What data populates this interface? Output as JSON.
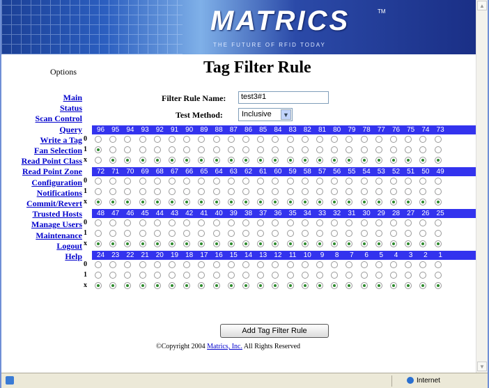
{
  "banner": {
    "logo_text": "MATRICS",
    "tm": "TM",
    "tagline": "THE FUTURE OF RFID TODAY"
  },
  "page": {
    "title": "Tag Filter Rule",
    "options_label": "Options"
  },
  "sidebar": {
    "items": [
      {
        "label": "Main"
      },
      {
        "label": "Status"
      },
      {
        "label": "Scan Control"
      },
      {
        "label": "Query"
      },
      {
        "label": "Write a Tag"
      },
      {
        "label": "Fan Selection"
      },
      {
        "label": "Read Point Class"
      },
      {
        "label": "Read Point Zone"
      },
      {
        "label": "Configuration"
      },
      {
        "label": "Notifications"
      },
      {
        "label": "Commit/Revert"
      },
      {
        "label": "Trusted Hosts"
      },
      {
        "label": "Manage Users"
      },
      {
        "label": "Maintenance"
      },
      {
        "label": "Logout"
      },
      {
        "label": "Help"
      }
    ]
  },
  "form": {
    "name_label": "Filter Rule Name:",
    "name_value": "test3#1",
    "method_label": "Test Method:",
    "method_value": "Inclusive",
    "add_button": "Add Tag Filter Rule"
  },
  "bit_grid": {
    "row_labels": [
      "0",
      "1",
      "x"
    ],
    "groups": [
      {
        "bits": [
          "96",
          "95",
          "94",
          "93",
          "92",
          "91",
          "90",
          "89",
          "88",
          "87",
          "86",
          "85",
          "84",
          "83",
          "82",
          "81",
          "80",
          "79",
          "78",
          "77",
          "76",
          "75",
          "74",
          "73"
        ],
        "selected": [
          "1",
          "x",
          "x",
          "x",
          "x",
          "x",
          "x",
          "x",
          "x",
          "x",
          "x",
          "x",
          "x",
          "x",
          "x",
          "x",
          "x",
          "x",
          "x",
          "x",
          "x",
          "x",
          "x",
          "x"
        ]
      },
      {
        "bits": [
          "72",
          "71",
          "70",
          "69",
          "68",
          "67",
          "66",
          "65",
          "64",
          "63",
          "62",
          "61",
          "60",
          "59",
          "58",
          "57",
          "56",
          "55",
          "54",
          "53",
          "52",
          "51",
          "50",
          "49"
        ],
        "selected": [
          "x",
          "x",
          "x",
          "x",
          "x",
          "x",
          "x",
          "x",
          "x",
          "x",
          "x",
          "x",
          "x",
          "x",
          "x",
          "x",
          "x",
          "x",
          "x",
          "x",
          "x",
          "x",
          "x",
          "x"
        ]
      },
      {
        "bits": [
          "48",
          "47",
          "46",
          "45",
          "44",
          "43",
          "42",
          "41",
          "40",
          "39",
          "38",
          "37",
          "36",
          "35",
          "34",
          "33",
          "32",
          "31",
          "30",
          "29",
          "28",
          "27",
          "26",
          "25"
        ],
        "selected": [
          "x",
          "x",
          "x",
          "x",
          "x",
          "x",
          "x",
          "x",
          "x",
          "x",
          "x",
          "x",
          "x",
          "x",
          "x",
          "x",
          "x",
          "x",
          "x",
          "x",
          "x",
          "x",
          "x",
          "x"
        ]
      },
      {
        "bits": [
          "24",
          "23",
          "22",
          "21",
          "20",
          "19",
          "18",
          "17",
          "16",
          "15",
          "14",
          "13",
          "12",
          "11",
          "10",
          "9",
          "8",
          "7",
          "6",
          "5",
          "4",
          "3",
          "2",
          "1"
        ],
        "selected": [
          "x",
          "x",
          "x",
          "x",
          "x",
          "x",
          "x",
          "x",
          "x",
          "x",
          "x",
          "x",
          "x",
          "x",
          "x",
          "x",
          "x",
          "x",
          "x",
          "x",
          "x",
          "x",
          "x",
          "x"
        ]
      }
    ]
  },
  "footer": {
    "copyright": "©Copyright 2004 ",
    "link": "Matrics, Inc.",
    "rights": " All Rights Reserved"
  },
  "statusbar": {
    "zone": "Internet"
  },
  "colors": {
    "header_blue": "#3333ee",
    "link_blue": "#0000cc",
    "radio_on": "#2c8a2c"
  }
}
